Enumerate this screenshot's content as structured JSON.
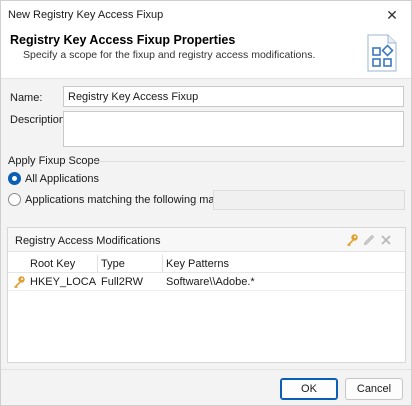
{
  "window": {
    "title": "New Registry Key Access Fixup"
  },
  "header": {
    "title": "Registry Key Access Fixup Properties",
    "subtitle": "Specify a scope for the fixup and registry access modifications.",
    "icon": "fixup-blocks-icon"
  },
  "form": {
    "name_label": "Name:",
    "name_value": "Registry Key Access Fixup",
    "description_label": "Description:",
    "description_value": ""
  },
  "scope": {
    "title": "Apply Fixup Scope",
    "options": [
      {
        "label": "All Applications",
        "checked": true
      },
      {
        "label": "Applications matching the following mask:",
        "checked": false
      }
    ],
    "mask_value": ""
  },
  "modifications": {
    "title": "Registry Access Modifications",
    "toolbar": [
      "key-icon",
      "pencil-icon",
      "delete-icon"
    ],
    "columns": [
      "Root Key",
      "Type",
      "Key Patterns"
    ],
    "rows": [
      {
        "icon": "key-icon",
        "root_key": "HKEY_LOCAL...",
        "type": "Full2RW",
        "key_patterns": "Software\\\\Adobe.*"
      }
    ]
  },
  "buttons": {
    "ok": "OK",
    "cancel": "Cancel"
  },
  "colors": {
    "accent": "#0a5fb4",
    "key": "#e0a030"
  }
}
